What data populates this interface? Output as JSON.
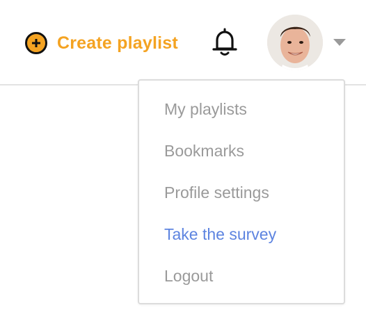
{
  "header": {
    "create_playlist": {
      "label": "Create playlist",
      "icon": "plus-circle-icon",
      "color": "#f4a322"
    },
    "notifications_icon": "bell-icon",
    "avatar_icon": "user-avatar",
    "menu_caret_icon": "caret-down-icon"
  },
  "menu": {
    "items": [
      {
        "label": "My playlists"
      },
      {
        "label": "Bookmarks"
      },
      {
        "label": "Profile settings"
      },
      {
        "label": "Take the survey",
        "color": "#5d84e0"
      },
      {
        "label": "Logout"
      }
    ],
    "text_color": "#9a9a9a"
  }
}
